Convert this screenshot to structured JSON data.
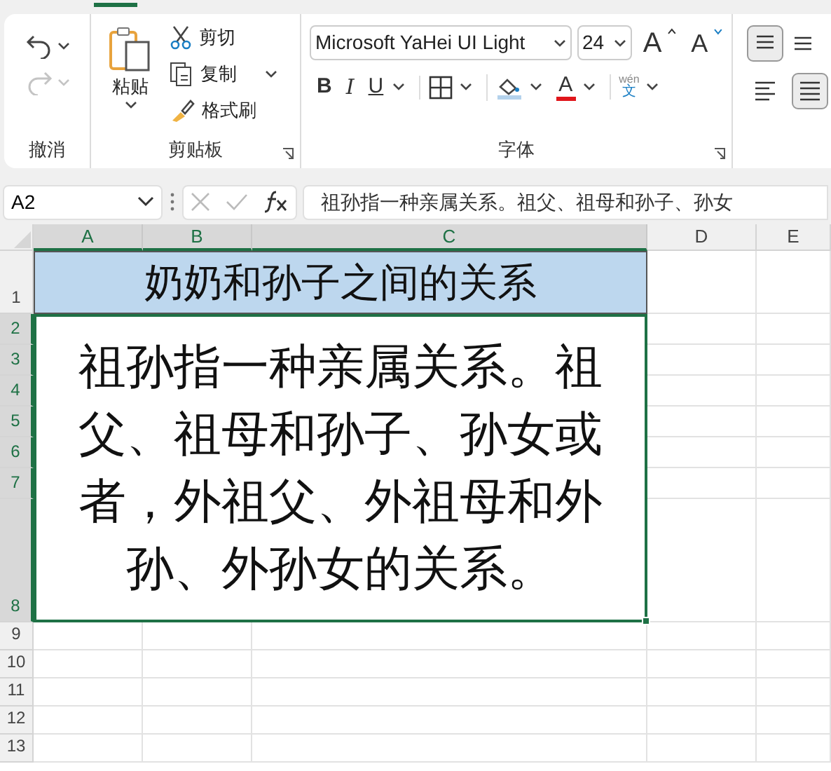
{
  "ribbon": {
    "groups": [
      {
        "kind": "undo",
        "label": "撤消",
        "redo_disabled": true
      },
      {
        "kind": "clipboard",
        "label": "剪贴板",
        "paste": "粘贴",
        "cut": "剪切",
        "copy": "复制",
        "painter": "格式刷"
      },
      {
        "kind": "font",
        "label": "字体",
        "font_name": "Microsoft YaHei UI Light",
        "font_size": "24",
        "grow": "A",
        "shrink": "A",
        "bold": "B",
        "italic": "I",
        "underline": "U",
        "font_color": "A",
        "phonetic_top": "wén",
        "phonetic_bottom": "文"
      },
      {
        "kind": "align"
      }
    ]
  },
  "name_box": "A2",
  "formula": "祖孙指一种亲属关系。祖父、祖母和孙子、孙女",
  "columns": [
    {
      "label": "A",
      "selected": true
    },
    {
      "label": "B",
      "selected": true
    },
    {
      "label": "C",
      "selected": true
    },
    {
      "label": "D",
      "selected": false
    },
    {
      "label": "E",
      "selected": false
    }
  ],
  "rows": [
    {
      "label": "1",
      "selected": false
    },
    {
      "label": "2",
      "selected": true
    },
    {
      "label": "3",
      "selected": true
    },
    {
      "label": "4",
      "selected": true
    },
    {
      "label": "5",
      "selected": true
    },
    {
      "label": "6",
      "selected": true
    },
    {
      "label": "7",
      "selected": true
    },
    {
      "label": "8",
      "selected": true
    },
    {
      "label": "9",
      "selected": false
    },
    {
      "label": "10",
      "selected": false
    },
    {
      "label": "11",
      "selected": false
    },
    {
      "label": "12",
      "selected": false
    },
    {
      "label": "13",
      "selected": false
    }
  ],
  "cells": [
    {
      "kind": "title",
      "text": "奶奶和孙子之间的关系"
    },
    {
      "kind": "body",
      "text": "祖孙指一种亲属关系。祖父、祖母和孙子、孙女或者，外祖父、外祖母和外孙、外孙女的关系。"
    }
  ]
}
